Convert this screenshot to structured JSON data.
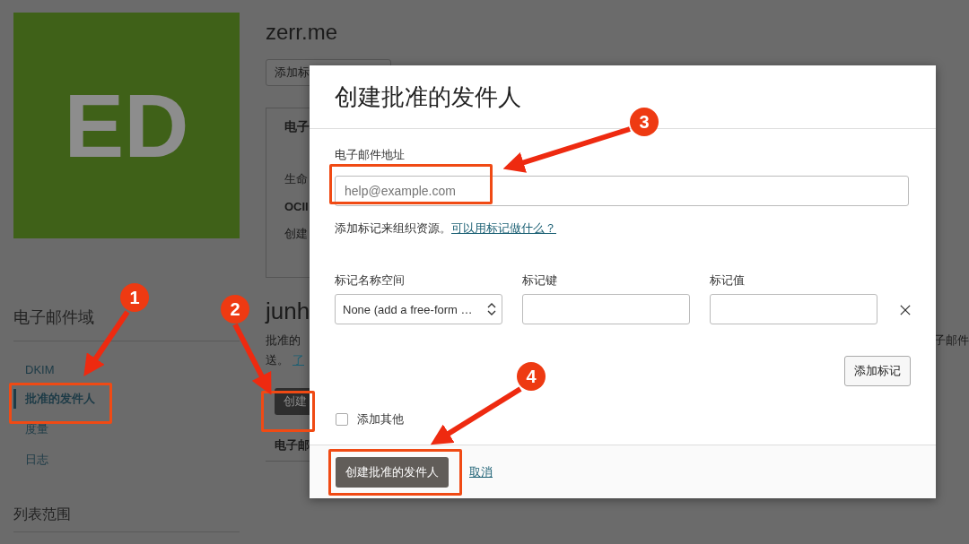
{
  "domain_logo": {
    "initials": "ED"
  },
  "sidebar": {
    "title": "电子邮件域",
    "items": [
      {
        "label": "DKIM",
        "selected": false
      },
      {
        "label": "批准的发件人",
        "selected": true
      },
      {
        "label": "度量",
        "selected": false
      },
      {
        "label": "日志",
        "selected": false
      }
    ],
    "scope_title": "列表范围"
  },
  "header": {
    "title": "zerr.me",
    "tag_button": "添加标"
  },
  "details_card": {
    "title": "电子",
    "rows": [
      {
        "text": "生命",
        "bold": false
      },
      {
        "text": "OCII",
        "bold": true
      },
      {
        "text": "创建",
        "bold": false
      }
    ]
  },
  "senders_section": {
    "title": "junh",
    "description": "批准的",
    "description_right": "子邮件",
    "description_line_2": "送。",
    "link": "了",
    "create_button": "创建",
    "table_header": "电子邮"
  },
  "modal": {
    "title": "创建批准的发件人",
    "email_label": "电子邮件地址",
    "email_placeholder": "help@example.com",
    "tag_hint": "添加标记来组织资源。",
    "tag_link": "可以用标记做什么？",
    "tag_columns": [
      "标记名称空间",
      "标记键",
      "标记值"
    ],
    "namespace_value": "None (add a free-form …",
    "add_tag_button": "添加标记",
    "add_another": {
      "label": "添加其他",
      "checked": false
    },
    "submit_button": "创建批准的发件人",
    "cancel_link": "取消"
  },
  "annotations": [
    {
      "number": "1"
    },
    {
      "number": "2"
    },
    {
      "number": "3"
    },
    {
      "number": "4"
    }
  ]
}
